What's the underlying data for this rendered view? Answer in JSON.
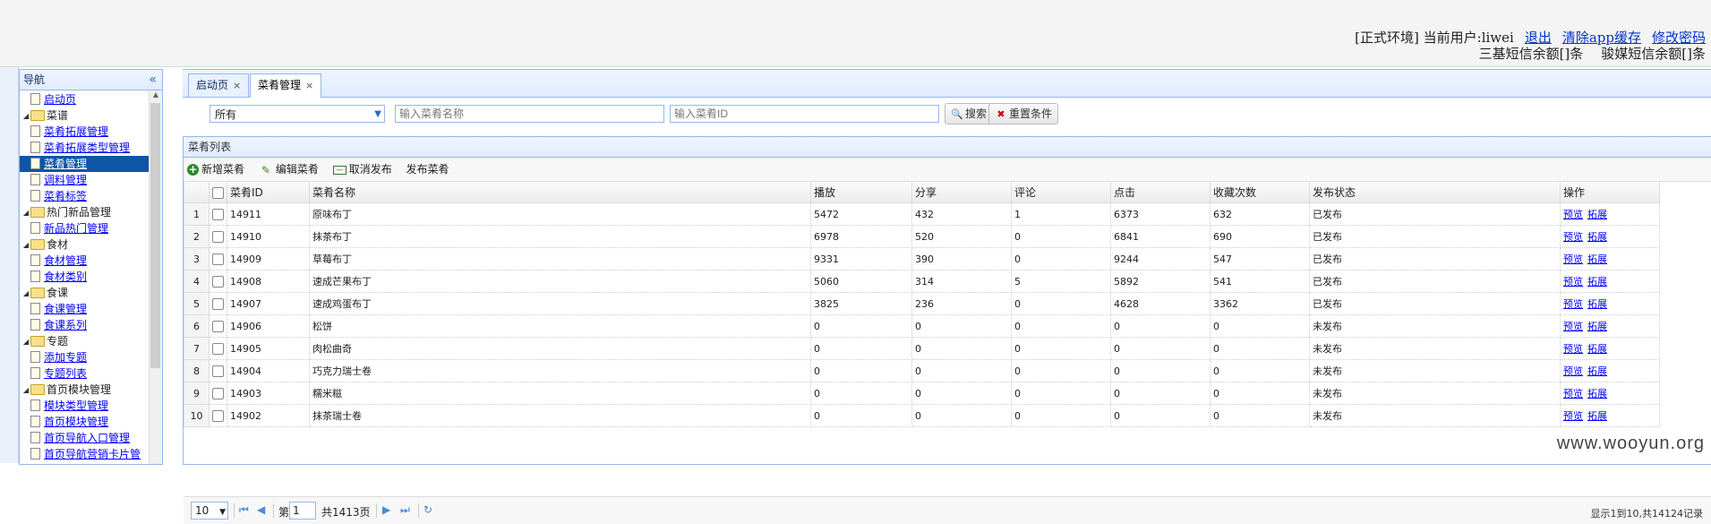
{
  "header": {
    "env": "[正式环境] 当前用户:liwei",
    "links": [
      "退出",
      "清除app缓存",
      "修改密码"
    ],
    "sms1": "三基短信余额[]条",
    "sms2": "骏媒短信余额[]条"
  },
  "nav": {
    "title": "导航",
    "collapse": "«",
    "items": [
      {
        "level": 1,
        "type": "leaf",
        "label": "启动页"
      },
      {
        "level": 0,
        "type": "folder",
        "label": "菜谱"
      },
      {
        "level": 1,
        "type": "leaf",
        "label": "菜肴拓展管理"
      },
      {
        "level": 1,
        "type": "leaf",
        "label": "菜肴拓展类型管理"
      },
      {
        "level": 1,
        "type": "leaf",
        "label": "菜肴管理",
        "selected": true
      },
      {
        "level": 1,
        "type": "leaf",
        "label": "调料管理"
      },
      {
        "level": 1,
        "type": "leaf",
        "label": "菜肴标签"
      },
      {
        "level": 0,
        "type": "folder",
        "label": "热门新品管理"
      },
      {
        "level": 1,
        "type": "leaf",
        "label": "新品热门管理"
      },
      {
        "level": 0,
        "type": "folder",
        "label": "食材"
      },
      {
        "level": 1,
        "type": "leaf",
        "label": "食材管理"
      },
      {
        "level": 1,
        "type": "leaf",
        "label": "食材类别"
      },
      {
        "level": 0,
        "type": "folder",
        "label": "食课"
      },
      {
        "level": 1,
        "type": "leaf",
        "label": "食课管理"
      },
      {
        "level": 1,
        "type": "leaf",
        "label": "食课系列"
      },
      {
        "level": 0,
        "type": "folder",
        "label": "专题"
      },
      {
        "level": 1,
        "type": "leaf",
        "label": "添加专题"
      },
      {
        "level": 1,
        "type": "leaf",
        "label": "专题列表"
      },
      {
        "level": 0,
        "type": "folder",
        "label": "首页模块管理"
      },
      {
        "level": 1,
        "type": "leaf",
        "label": "模块类型管理"
      },
      {
        "level": 1,
        "type": "leaf",
        "label": "首页模块管理"
      },
      {
        "level": 1,
        "type": "leaf",
        "label": "首页导航入口管理"
      },
      {
        "level": 1,
        "type": "leaf",
        "label": "首页导航营销卡片管"
      }
    ]
  },
  "tabs": [
    {
      "label": "启动页",
      "close": "×"
    },
    {
      "label": "菜肴管理",
      "close": "×",
      "active": true
    }
  ],
  "search": {
    "select_value": "所有",
    "name_placeholder": "输入菜肴名称",
    "id_placeholder": "输入菜肴ID",
    "search_label": "搜索",
    "reset_label": "重置条件"
  },
  "panel": {
    "title": "菜肴列表",
    "toolbar": [
      "新增菜肴",
      "编辑菜肴",
      "取消发布",
      "发布菜肴"
    ]
  },
  "table": {
    "columns": [
      "菜肴ID",
      "菜肴名称",
      "播放",
      "分享",
      "评论",
      "点击",
      "收藏次数",
      "发布状态",
      "操作"
    ],
    "rows": [
      {
        "n": "1",
        "id": "14911",
        "name": "原味布丁",
        "play": "5472",
        "share": "432",
        "comment": "1",
        "click": "6373",
        "fav": "632",
        "status": "已发布"
      },
      {
        "n": "2",
        "id": "14910",
        "name": "抹茶布丁",
        "play": "6978",
        "share": "520",
        "comment": "0",
        "click": "6841",
        "fav": "690",
        "status": "已发布"
      },
      {
        "n": "3",
        "id": "14909",
        "name": "草莓布丁",
        "play": "9331",
        "share": "390",
        "comment": "0",
        "click": "9244",
        "fav": "547",
        "status": "已发布"
      },
      {
        "n": "4",
        "id": "14908",
        "name": "速成芒果布丁",
        "play": "5060",
        "share": "314",
        "comment": "5",
        "click": "5892",
        "fav": "541",
        "status": "已发布"
      },
      {
        "n": "5",
        "id": "14907",
        "name": "速成鸡蛋布丁",
        "play": "3825",
        "share": "236",
        "comment": "0",
        "click": "4628",
        "fav": "3362",
        "status": "已发布"
      },
      {
        "n": "6",
        "id": "14906",
        "name": "松饼",
        "play": "0",
        "share": "0",
        "comment": "0",
        "click": "0",
        "fav": "0",
        "status": "未发布"
      },
      {
        "n": "7",
        "id": "14905",
        "name": "肉松曲奇",
        "play": "0",
        "share": "0",
        "comment": "0",
        "click": "0",
        "fav": "0",
        "status": "未发布"
      },
      {
        "n": "8",
        "id": "14904",
        "name": "巧克力瑞士卷",
        "play": "0",
        "share": "0",
        "comment": "0",
        "click": "0",
        "fav": "0",
        "status": "未发布"
      },
      {
        "n": "9",
        "id": "14903",
        "name": "糯米糍",
        "play": "0",
        "share": "0",
        "comment": "0",
        "click": "0",
        "fav": "0",
        "status": "未发布"
      },
      {
        "n": "10",
        "id": "14902",
        "name": "抹茶瑞士卷",
        "play": "0",
        "share": "0",
        "comment": "0",
        "click": "0",
        "fav": "0",
        "status": "未发布"
      }
    ],
    "actions": [
      "预览",
      "拓展"
    ]
  },
  "pager": {
    "page_size": "10",
    "page_label": "第",
    "page": "1",
    "total_pages": "共1413页",
    "info": "显示1到10,共14124记录"
  },
  "watermark": "www.wooyun.org"
}
